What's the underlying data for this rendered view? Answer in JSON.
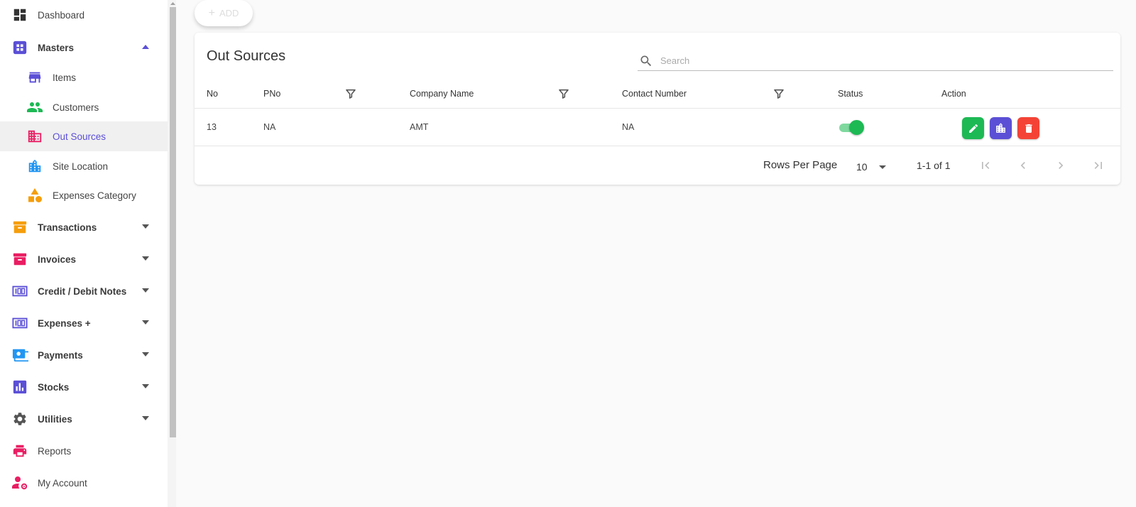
{
  "sidebar": {
    "items": [
      {
        "label": "Dashboard",
        "icon": "dashboard-icon",
        "color": "#333333"
      },
      {
        "label": "Masters",
        "icon": "apps-icon",
        "color": "#5b4fd6"
      },
      {
        "label": "Items",
        "icon": "store-icon",
        "color": "#5b4fd6"
      },
      {
        "label": "Customers",
        "icon": "people-icon",
        "color": "#1db954"
      },
      {
        "label": "Out Sources",
        "icon": "building-icon",
        "color": "#e91e63"
      },
      {
        "label": "Site Location",
        "icon": "city-icon",
        "color": "#2196f3"
      },
      {
        "label": "Expenses Category",
        "icon": "category-icon",
        "color": "#f59e0b"
      },
      {
        "label": "Transactions",
        "icon": "transactions-icon",
        "color": "#f59e0b"
      },
      {
        "label": "Invoices",
        "icon": "invoice-icon",
        "color": "#e91e63"
      },
      {
        "label": "Credit / Debit Notes",
        "icon": "notes-icon",
        "color": "#5b4fd6"
      },
      {
        "label": "Expenses +",
        "icon": "expenses-icon",
        "color": "#5b4fd6"
      },
      {
        "label": "Payments",
        "icon": "payments-icon",
        "color": "#2196f3"
      },
      {
        "label": "Stocks",
        "icon": "stocks-icon",
        "color": "#5b4fd6"
      },
      {
        "label": "Utilities",
        "icon": "gear-icon",
        "color": "#555555"
      },
      {
        "label": "Reports",
        "icon": "printer-icon",
        "color": "#e91e63"
      },
      {
        "label": "My Account",
        "icon": "account-settings-icon",
        "color": "#e91e63"
      }
    ]
  },
  "toolbar": {
    "add_label": "ADD"
  },
  "card": {
    "title": "Out Sources",
    "search_placeholder": "Search",
    "columns": [
      "No",
      "PNo",
      "Company Name",
      "Contact Number",
      "Status",
      "Action"
    ],
    "rows": [
      {
        "no": "13",
        "pno": "NA",
        "company": "AMT",
        "contact": "NA",
        "status_on": true
      }
    ],
    "pager": {
      "rows_label": "Rows Per Page",
      "rows_value": "10",
      "range": "1-1 of 1"
    }
  },
  "colors": {
    "accent": "#5b4fd6",
    "edit": "#1db954",
    "site": "#5b4fd6",
    "delete": "#f44336"
  }
}
